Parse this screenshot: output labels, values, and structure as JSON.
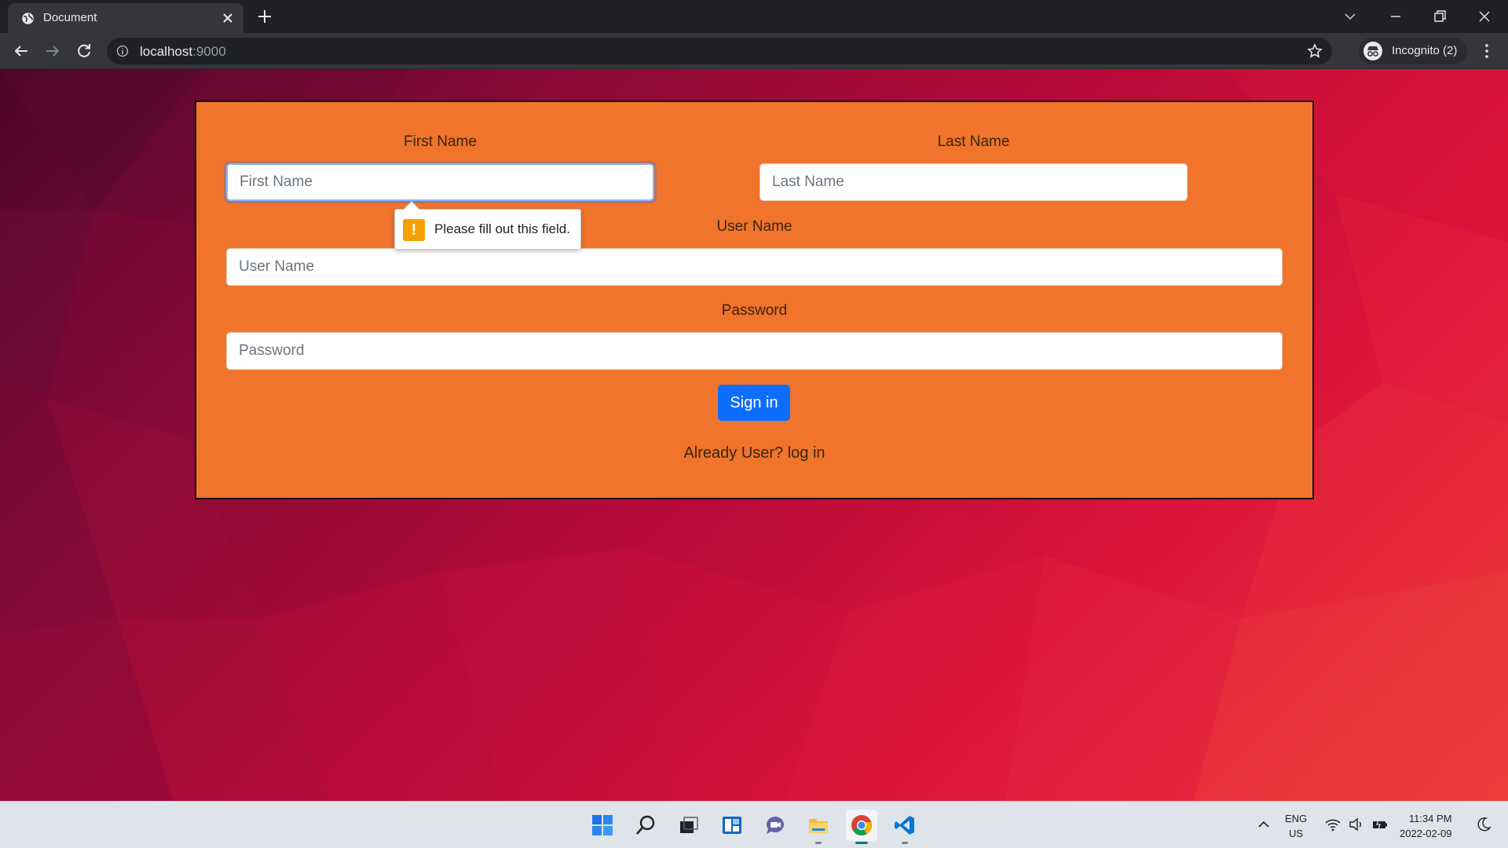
{
  "browser": {
    "tab_title": "Document",
    "url_host": "localhost",
    "url_port": ":9000",
    "profile_label": "Incognito (2)"
  },
  "form": {
    "first_name_label": "First Name",
    "first_name_placeholder": "First Name",
    "first_name_value": "",
    "last_name_label": "Last Name",
    "last_name_placeholder": "Last Name",
    "last_name_value": "",
    "user_name_label": "User Name",
    "user_name_placeholder": "User Name",
    "user_name_value": "",
    "password_label": "Password",
    "password_placeholder": "Password",
    "password_value": "",
    "submit_label": "Sign in",
    "login_link": "Already User? log in",
    "validation_message": "Please fill out this field."
  },
  "taskbar": {
    "apps": [
      "start-icon",
      "search-icon",
      "task-view-icon",
      "widgets-icon",
      "chat-icon",
      "file-explorer-icon",
      "chrome-icon",
      "vscode-icon"
    ],
    "language_line1": "ENG",
    "language_line2": "US",
    "time": "11:34 PM",
    "date": "2022-02-09"
  },
  "colors": {
    "form_background": "#f0742b",
    "button_primary": "#0d6efd",
    "warning_icon": "#f7a000"
  }
}
